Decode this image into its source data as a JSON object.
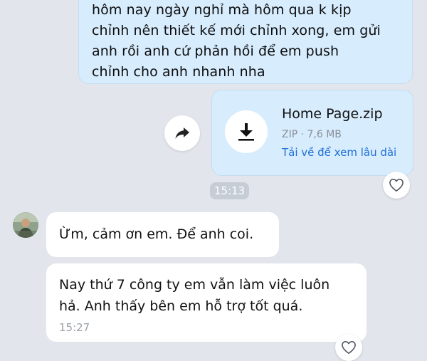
{
  "messages": {
    "outgoing_text": {
      "lines": [
        "hôm nay ngày nghỉ mà hôm qua k kịp",
        "chỉnh nên thiết kế mới chỉnh xong, em gửi",
        "anh rồi anh cứ phản hồi để em push",
        "chỉnh cho anh nhanh nha"
      ]
    },
    "file": {
      "name": "Home Page.zip",
      "meta": "ZIP · 7,6 MB",
      "link": "Tải về để xem lâu dài",
      "icon": "download-icon"
    },
    "time_divider": "15:13",
    "incoming": [
      {
        "text": "Ừm, cảm ơn em. Để anh coi."
      },
      {
        "lines": [
          "Nay thứ 7 công ty em vẫn làm việc luôn",
          "hả. Anh thấy bên em hỗ trợ tốt quá."
        ],
        "time": "15:27"
      }
    ]
  },
  "icons": {
    "forward": "forward-icon",
    "reaction": "heart-icon",
    "avatar": "avatar"
  },
  "colors": {
    "background": "#e2e6ec",
    "outgoing_bubble": "#d7ecfd",
    "incoming_bubble": "#ffffff",
    "link": "#1f6fd6",
    "muted_text": "#8a8f97"
  }
}
